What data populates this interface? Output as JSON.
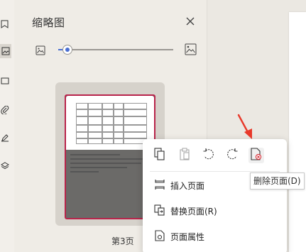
{
  "panel": {
    "title": "缩略图",
    "zoom_level_percent": 8
  },
  "thumbnail": {
    "page_label": "第3页"
  },
  "context_menu": {
    "toolbar_buttons": [
      {
        "icon": "copy-page-icon"
      },
      {
        "icon": "paste-page-icon"
      },
      {
        "icon": "rotate-left-icon"
      },
      {
        "icon": "rotate-right-icon"
      },
      {
        "icon": "delete-page-icon"
      }
    ],
    "items": [
      {
        "label": "插入页面",
        "icon": "insert-page-icon"
      },
      {
        "label": "替换页面(R)",
        "icon": "replace-page-icon"
      },
      {
        "label": "页面属性",
        "icon": "page-properties-icon"
      }
    ]
  },
  "tooltip": {
    "text": "删除页面(D)"
  },
  "colors": {
    "accent": "#4a6fd1",
    "selection": "#b8234a",
    "arrow": "#e8392a",
    "delete_badge": "#d9313a"
  }
}
